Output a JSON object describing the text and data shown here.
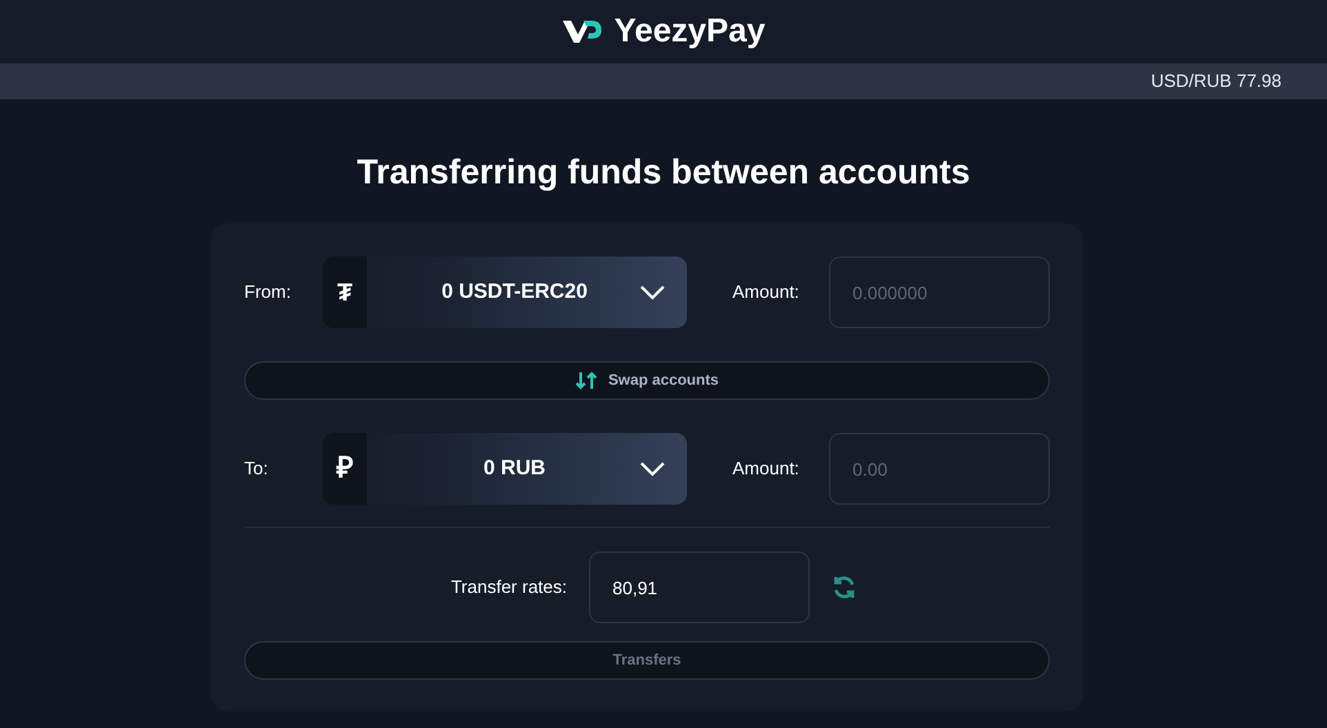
{
  "brand": {
    "name": "YeezyPay"
  },
  "ticker": {
    "text": "USD/RUB 77.98"
  },
  "title": "Transferring funds between accounts",
  "accounts": [
    {
      "label": "From:",
      "kind": "tether",
      "symbol": "₮",
      "balance": "0 USDT-ERC20",
      "amount_label": "Amount:",
      "placeholder": "0.000000"
    },
    {
      "label": "To:",
      "kind": "ruble",
      "symbol": "₽",
      "balance": "0 RUB",
      "amount_label": "Amount:",
      "placeholder": "0.00"
    }
  ],
  "swap_button": "Swap accounts",
  "rate": {
    "label": "Transfer rates:",
    "value": "80,91"
  },
  "submit": {
    "label": "Transfers",
    "disabled": true
  }
}
